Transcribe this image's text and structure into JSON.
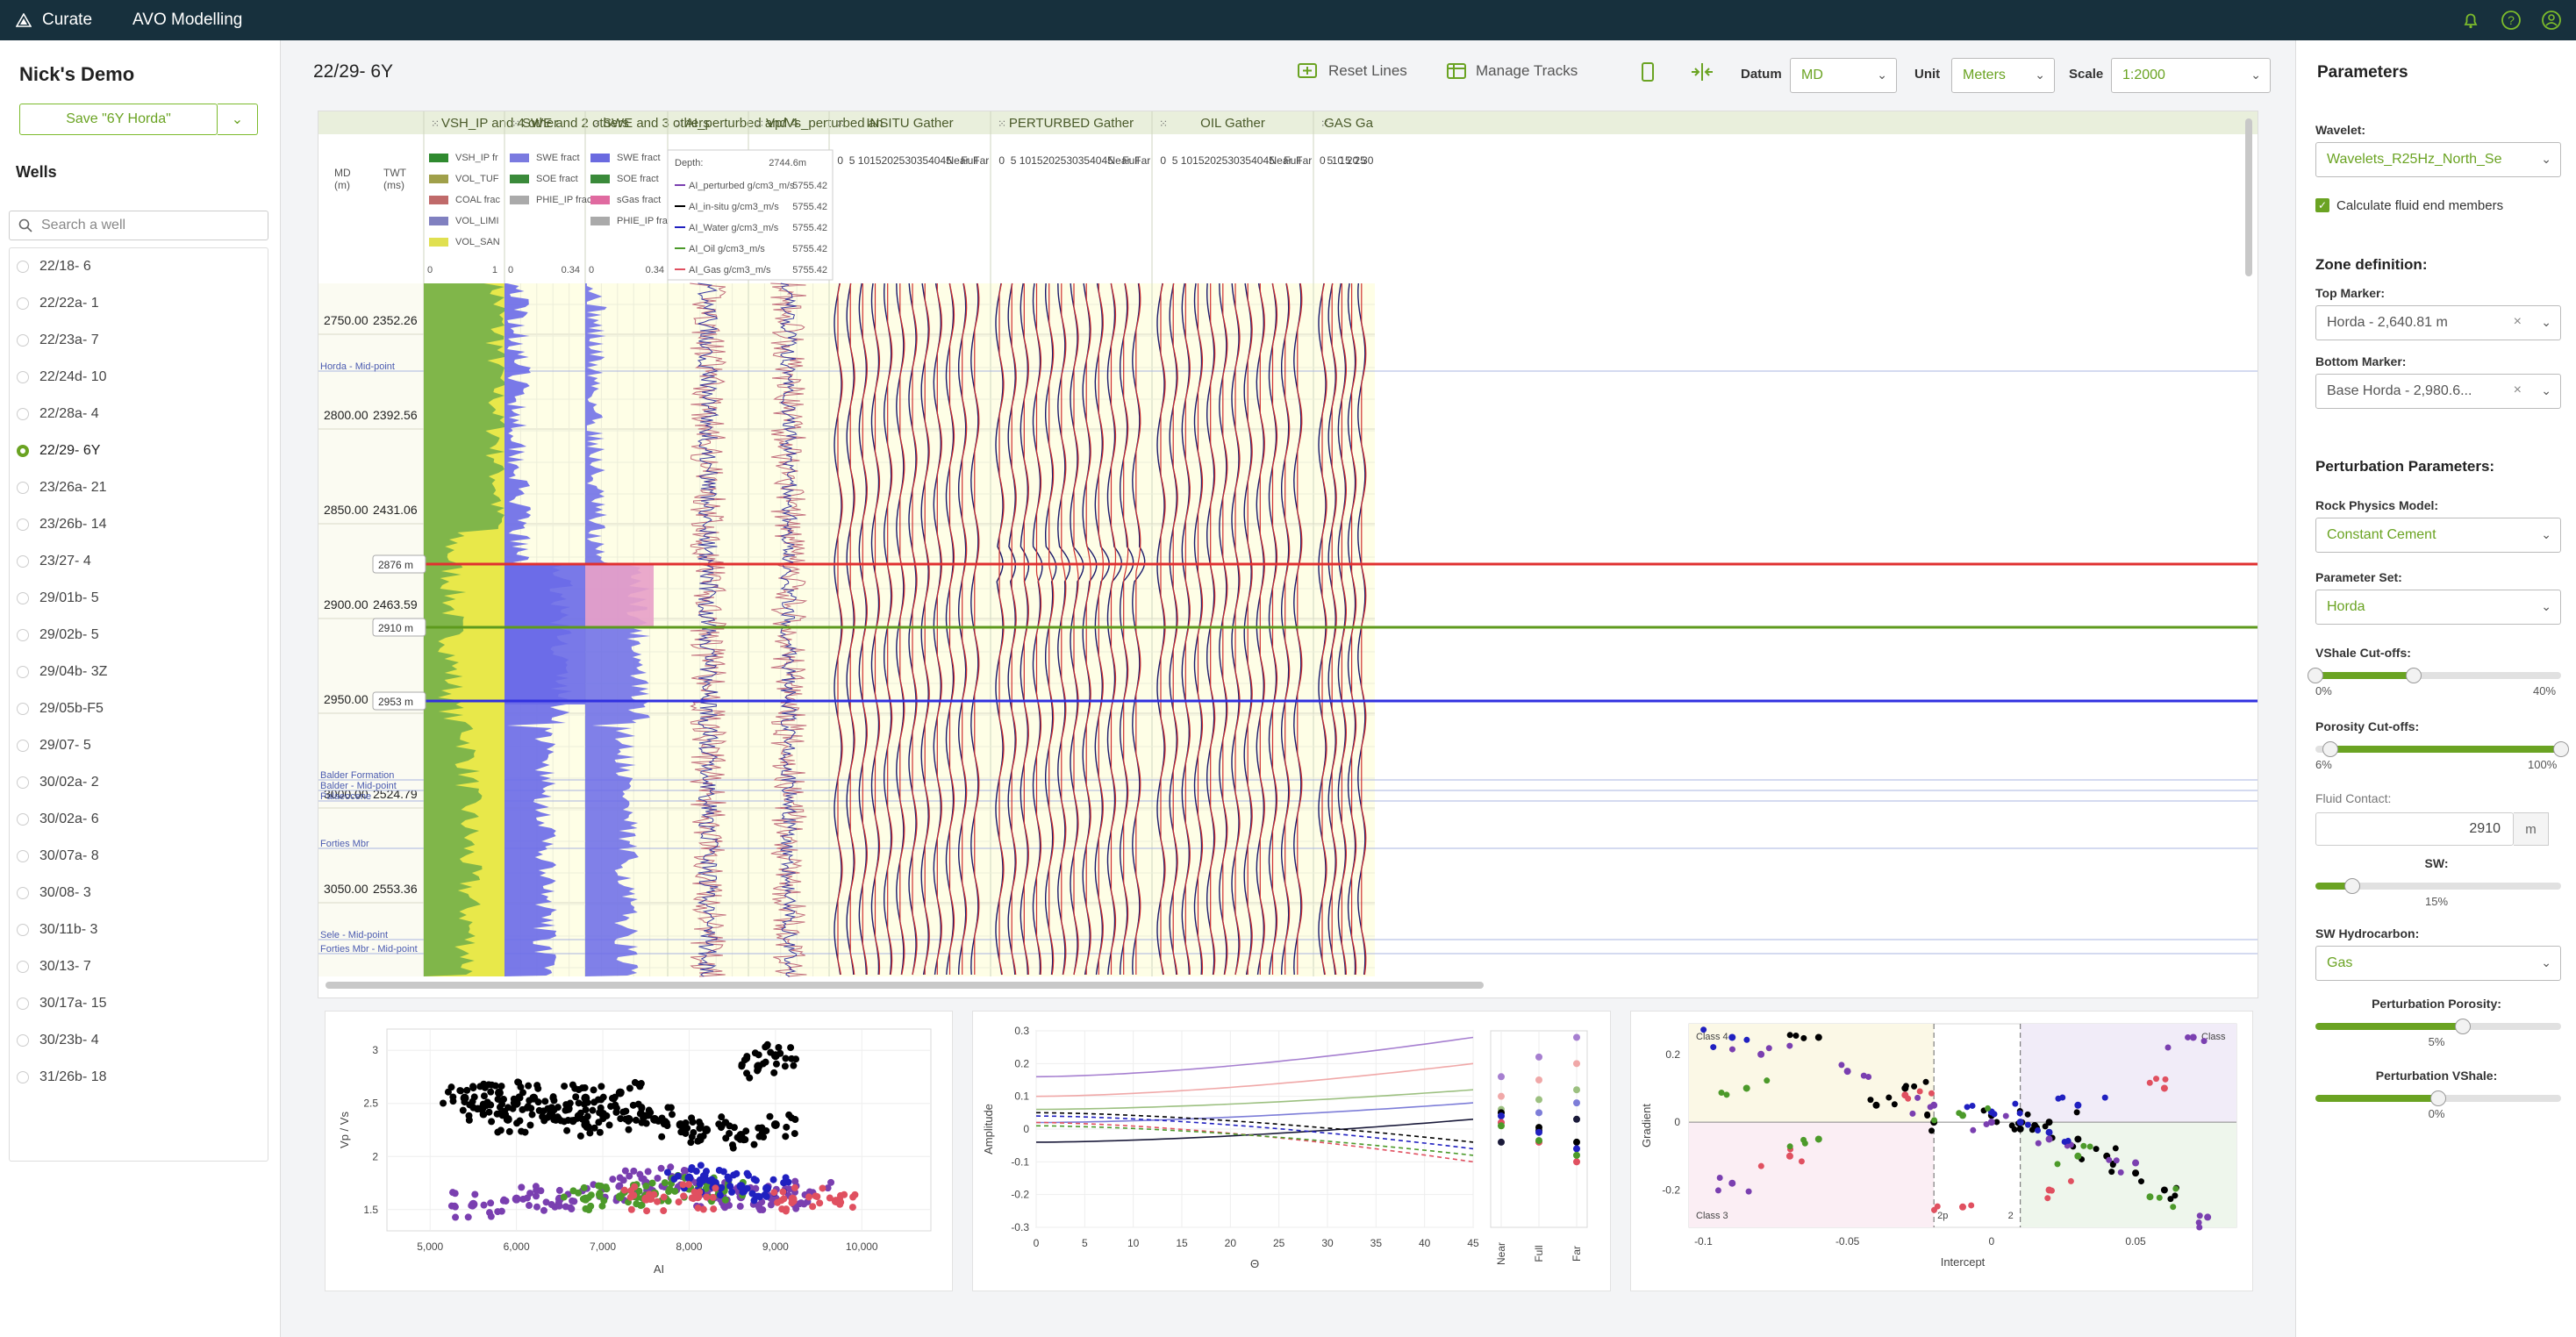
{
  "topbar": {
    "brand": "Curate",
    "app_name": "AVO Modelling"
  },
  "colors": {
    "accent": "#6aa322",
    "topbar": "#17303d",
    "marker_top": "#e03030",
    "marker_mid": "#5e9a1e",
    "marker_base": "#3030e0"
  },
  "left": {
    "title": "Nick's Demo",
    "save_label": "Save \"6Y Horda\"",
    "wells_heading": "Wells",
    "search_placeholder": "Search a well",
    "wells": [
      "22/18- 6",
      "22/22a- 1",
      "22/23a- 7",
      "22/24d- 10",
      "22/28a- 4",
      "22/29- 6Y",
      "23/26a- 21",
      "23/26b- 14",
      "23/27- 4",
      "29/01b- 5",
      "29/02b- 5",
      "29/04b- 3Z",
      "29/05b-F5",
      "29/07- 5",
      "30/02a- 2",
      "30/02a- 6",
      "30/07a- 8",
      "30/08- 3",
      "30/11b- 3",
      "30/13- 7",
      "30/17a- 15",
      "30/23b- 4",
      "31/26b- 18"
    ],
    "selected_index": 5
  },
  "main": {
    "well_title": "22/29- 6Y",
    "reset_lines": "Reset Lines",
    "manage_tracks": "Manage Tracks",
    "datum_label": "Datum",
    "datum_value": "MD",
    "unit_label": "Unit",
    "unit_value": "Meters",
    "scale_label": "Scale",
    "scale_value": "1:2000"
  },
  "tracks": {
    "headers": [
      "VSH_IP and 4 other",
      "SWE and 2 others",
      "SWE and 3 others",
      "AI_perturbed and 4",
      "Vp/Vs_perturbed an",
      "INSITU Gather",
      "PERTURBED Gather",
      "OIL Gather",
      "GAS Ga"
    ],
    "md_header": "MD\n(m)",
    "twt_header": "TWT\n(ms)",
    "md_unit": "(m)",
    "twt_unit": "(ms)",
    "depth_rows": [
      {
        "md": "2750.00",
        "twt": "2352.26"
      },
      {
        "md": "2800.00",
        "twt": "2392.56"
      },
      {
        "md": "2850.00",
        "twt": "2431.06"
      },
      {
        "md": "2900.00",
        "twt": "2463.59"
      },
      {
        "md": "2950.00",
        "twt": "2492.20"
      },
      {
        "md": "3000.00",
        "twt": "2524.79"
      },
      {
        "md": "3050.00",
        "twt": "2553.36"
      }
    ],
    "formation_labels": [
      "Horda - Mid-point",
      "Balder Formation",
      "Balder - Mid-point",
      "Palaeocene",
      "Forties Mbr",
      "Sele - Mid-point",
      "Forties Mbr - Mid-point"
    ],
    "markers": [
      "2876 m",
      "2910 m",
      "2953 m"
    ],
    "legend1": [
      "VSH_IP fr",
      "VOL_TUF",
      "COAL frac",
      "VOL_LIMI",
      "VOL_SAN"
    ],
    "legend2": [
      "SWE fract",
      "SOE fract",
      "PHIE_IP frac"
    ],
    "legend3": [
      "SWE fract",
      "SOE fract",
      "sGas fract",
      "PHIE_IP fract"
    ],
    "legend1_scale": [
      "0",
      "1"
    ],
    "legend2_scale": [
      "0",
      "0.34"
    ],
    "legend3_scale": [
      "0",
      "0.34"
    ],
    "vpvs_scale": "2.98",
    "tooltip": {
      "depth_label": "Depth:",
      "depth_value": "2744.6m",
      "rows": [
        {
          "name": "AI_perturbed g/cm3_m/s",
          "value": "5755.42",
          "color": "#7a3fb0"
        },
        {
          "name": "AI_in-situ g/cm3_m/s",
          "value": "5755.42",
          "color": "#000000"
        },
        {
          "name": "AI_Water g/cm3_m/s",
          "value": "5755.42",
          "color": "#2020c0"
        },
        {
          "name": "AI_Oil g/cm3_m/s",
          "value": "5755.42",
          "color": "#4c9a2a"
        },
        {
          "name": "AI_Gas g/cm3_m/s",
          "value": "5755.42",
          "color": "#e05060"
        }
      ]
    },
    "gather_ticks": [
      "0",
      "5",
      "10",
      "15",
      "20",
      "25",
      "30",
      "35",
      "40",
      "45",
      "Near",
      "Full",
      "Far"
    ]
  },
  "chart_data": [
    {
      "type": "scatter",
      "xlabel": "AI",
      "ylabel": "Vp / Vs",
      "xlim": [
        4500,
        10800
      ],
      "ylim": [
        1.3,
        3.2
      ],
      "xticks": [
        "5,000",
        "6,000",
        "7,000",
        "8,000",
        "9,000",
        "10,000"
      ],
      "yticks": [
        "1.5",
        "2",
        "2.5",
        "3"
      ],
      "series": [
        {
          "color": "#000000",
          "points": [
            [
              5400,
              2.55
            ],
            [
              5600,
              2.45
            ],
            [
              5800,
              2.6
            ],
            [
              6000,
              2.5
            ],
            [
              6200,
              2.55
            ],
            [
              6400,
              2.4
            ],
            [
              6600,
              2.45
            ],
            [
              6800,
              2.55
            ],
            [
              7000,
              2.4
            ],
            [
              7300,
              2.35
            ],
            [
              7600,
              2.35
            ],
            [
              7900,
              2.3
            ],
            [
              8200,
              2.25
            ],
            [
              8600,
              2.2
            ],
            [
              9000,
              2.3
            ],
            [
              8800,
              2.85
            ],
            [
              9000,
              2.95
            ],
            [
              7200,
              2.6
            ],
            [
              6800,
              2.3
            ],
            [
              5900,
              2.35
            ]
          ]
        },
        {
          "color": "#7a3fb0",
          "points": [
            [
              5500,
              1.55
            ],
            [
              6000,
              1.6
            ],
            [
              6500,
              1.6
            ],
            [
              7000,
              1.7
            ],
            [
              7500,
              1.75
            ],
            [
              7800,
              1.8
            ],
            [
              8200,
              1.65
            ],
            [
              8600,
              1.62
            ],
            [
              9000,
              1.6
            ],
            [
              9400,
              1.65
            ]
          ]
        },
        {
          "color": "#4c9a2a",
          "points": [
            [
              6800,
              1.6
            ],
            [
              7200,
              1.62
            ],
            [
              7600,
              1.65
            ],
            [
              8000,
              1.7
            ],
            [
              8400,
              1.68
            ]
          ]
        },
        {
          "color": "#2020c0",
          "points": [
            [
              8000,
              1.8
            ],
            [
              8300,
              1.75
            ],
            [
              8600,
              1.72
            ],
            [
              8900,
              1.7
            ]
          ]
        },
        {
          "color": "#e05060",
          "points": [
            [
              7500,
              1.6
            ],
            [
              8100,
              1.62
            ],
            [
              9200,
              1.6
            ],
            [
              9700,
              1.58
            ]
          ]
        }
      ]
    },
    {
      "type": "line",
      "xlabel": "Θ",
      "ylabel": "Amplitude",
      "xlim": [
        0,
        45
      ],
      "ylim": [
        -0.3,
        0.3
      ],
      "xticks": [
        "0",
        "5",
        "10",
        "15",
        "20",
        "25",
        "30",
        "35",
        "40",
        "45"
      ],
      "yticks": [
        "0.3",
        "0.2",
        "0.1",
        "0",
        "-0.1",
        "-0.2",
        "-0.3"
      ],
      "side_labels": [
        "Near",
        "Full",
        "Far"
      ],
      "series": [
        {
          "color": "#a67fd0",
          "values": [
            0.16,
            0.28
          ]
        },
        {
          "color": "#f0a8a8",
          "values": [
            0.1,
            0.2
          ]
        },
        {
          "color": "#9cc080",
          "values": [
            0.06,
            0.12
          ]
        },
        {
          "color": "#7d7dd8",
          "values": [
            0.02,
            0.08
          ]
        },
        {
          "color": "#1a1a3a",
          "values": [
            -0.04,
            0.03
          ]
        },
        {
          "color": "#000000",
          "dash": true,
          "values": [
            0.05,
            -0.04
          ]
        },
        {
          "color": "#2020c0",
          "dash": true,
          "values": [
            0.04,
            -0.06
          ]
        },
        {
          "color": "#e05060",
          "dash": true,
          "values": [
            0.02,
            -0.1
          ]
        },
        {
          "color": "#4c9a2a",
          "dash": true,
          "values": [
            0.01,
            -0.08
          ]
        }
      ]
    },
    {
      "type": "scatter",
      "xlabel": "Intercept",
      "ylabel": "Gradient",
      "xlim": [
        -0.105,
        0.085
      ],
      "ylim": [
        -0.31,
        0.29
      ],
      "xticks": [
        "-0.1",
        "-0.05",
        "0",
        "0.05"
      ],
      "yticks": [
        "0.2",
        "0",
        "-0.2"
      ],
      "class_labels": [
        "Class 4",
        "Class 3",
        "Class",
        "2p",
        "2"
      ],
      "series": [
        {
          "color": "#000000",
          "points": [
            [
              -0.06,
              0.25
            ],
            [
              -0.04,
              0.05
            ],
            [
              -0.02,
              0.0
            ],
            [
              0.0,
              0.02
            ],
            [
              0.01,
              -0.02
            ],
            [
              0.02,
              0.0
            ],
            [
              0.03,
              -0.05
            ],
            [
              0.04,
              -0.1
            ],
            [
              0.05,
              -0.15
            ],
            [
              0.06,
              -0.2
            ],
            [
              -0.03,
              0.1
            ],
            [
              0.015,
              -0.01
            ]
          ]
        },
        {
          "color": "#7a3fb0",
          "points": [
            [
              -0.08,
              0.2
            ],
            [
              -0.05,
              0.15
            ],
            [
              -0.02,
              0.05
            ],
            [
              0.0,
              0.0
            ],
            [
              0.02,
              -0.05
            ],
            [
              0.05,
              -0.12
            ],
            [
              0.07,
              0.25
            ],
            [
              -0.09,
              -0.18
            ],
            [
              0.075,
              -0.28
            ]
          ]
        },
        {
          "color": "#2020c0",
          "points": [
            [
              -0.09,
              0.25
            ],
            [
              0.0,
              0.03
            ],
            [
              0.01,
              0.0
            ],
            [
              0.02,
              -0.03
            ],
            [
              0.03,
              0.05
            ]
          ]
        },
        {
          "color": "#e05060",
          "points": [
            [
              -0.07,
              -0.1
            ],
            [
              -0.03,
              0.08
            ],
            [
              0.02,
              -0.2
            ],
            [
              0.06,
              0.1
            ],
            [
              -0.01,
              -0.25
            ]
          ]
        },
        {
          "color": "#4c9a2a",
          "points": [
            [
              -0.06,
              -0.05
            ],
            [
              -0.01,
              0.02
            ],
            [
              0.03,
              -0.1
            ],
            [
              0.055,
              -0.22
            ],
            [
              -0.085,
              0.1
            ]
          ]
        }
      ]
    }
  ],
  "right": {
    "title": "Parameters",
    "wavelet_label": "Wavelet:",
    "wavelet_value": "Wavelets_R25Hz_North_Se",
    "calc_fluid": "Calculate fluid end members",
    "zone_title": "Zone definition:",
    "top_marker_label": "Top Marker:",
    "top_marker_value": "Horda - 2,640.81 m",
    "bottom_marker_label": "Bottom Marker:",
    "bottom_marker_value": "Base Horda - 2,980.6...",
    "perturb_title": "Perturbation Parameters:",
    "rock_label": "Rock Physics Model:",
    "rock_value": "Constant Cement",
    "paramset_label": "Parameter Set:",
    "paramset_value": "Horda",
    "vshale_label": "VShale Cut-offs:",
    "vshale_min": "0%",
    "vshale_max": "40%",
    "vshale_range": [
      0,
      40
    ],
    "porosity_label": "Porosity Cut-offs:",
    "porosity_min": "6%",
    "porosity_max": "100%",
    "porosity_range": [
      6,
      100
    ],
    "fluid_contact_label": "Fluid Contact:",
    "fluid_contact_value": "2910",
    "fluid_contact_unit": "m",
    "sw_label": "SW:",
    "sw_value": "15%",
    "sw_level": 15,
    "swh_label": "SW Hydrocarbon:",
    "swh_value": "Gas",
    "pert_porosity_label": "Perturbation Porosity:",
    "pert_porosity_value": "5%",
    "pert_porosity_level": 60,
    "pert_vshale_label": "Perturbation VShale:",
    "pert_vshale_value": "0%",
    "pert_vshale_level": 50
  }
}
